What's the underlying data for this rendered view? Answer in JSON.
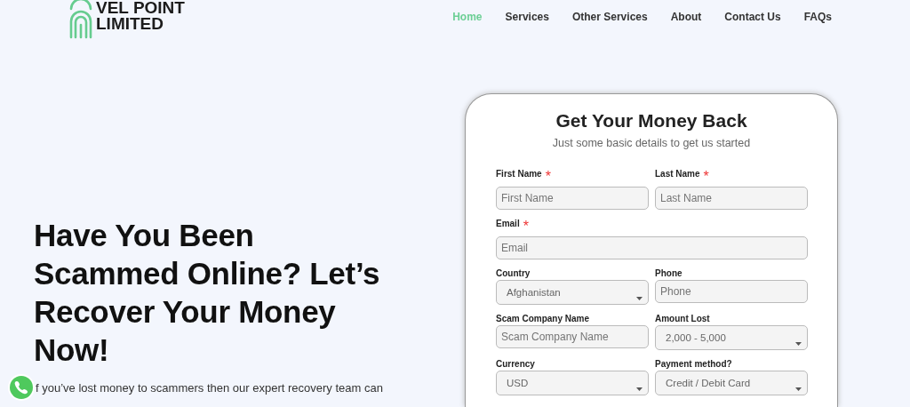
{
  "logo": {
    "line_1": "VEL POINT",
    "line_2": "LIMITED"
  },
  "nav": [
    {
      "label": "Home",
      "selected": true
    },
    {
      "label": "Services",
      "selected": false
    },
    {
      "label": "Other Services",
      "selected": false
    },
    {
      "label": "About",
      "selected": false
    },
    {
      "label": "Contact Us",
      "selected": false
    },
    {
      "label": "FAQs",
      "selected": false
    }
  ],
  "hero": {
    "heading": "Have You Been Scammed Online? Let’s Recover Your Money Now!",
    "text": "f you’ve lost money to scammers then our expert recovery team can"
  },
  "form": {
    "title": "Get Your Money Back",
    "subtitle": "Just some basic details to get us started",
    "fields": [
      {
        "kind": "input",
        "label": "First Name",
        "marker": "*",
        "placeholder": "First Name"
      },
      {
        "kind": "input",
        "label": "Last Name",
        "marker": "*",
        "placeholder": "Last Name"
      },
      {
        "kind": "input",
        "label": "Email",
        "marker": "*",
        "placeholder": "Email",
        "wide": true
      },
      {
        "kind": "select",
        "label": "Country",
        "value": "Afghanistan"
      },
      {
        "kind": "input",
        "label": "Phone",
        "placeholder": "Phone"
      },
      {
        "kind": "input",
        "label": "Scam Company Name",
        "placeholder": "Scam Company Name"
      },
      {
        "kind": "select",
        "label": "Amount Lost",
        "value": "2,000 - 5,000"
      },
      {
        "kind": "select",
        "label": "Currency",
        "value": "USD"
      },
      {
        "kind": "select",
        "label": "Payment method?",
        "value": "Credit / Debit Card"
      }
    ]
  }
}
